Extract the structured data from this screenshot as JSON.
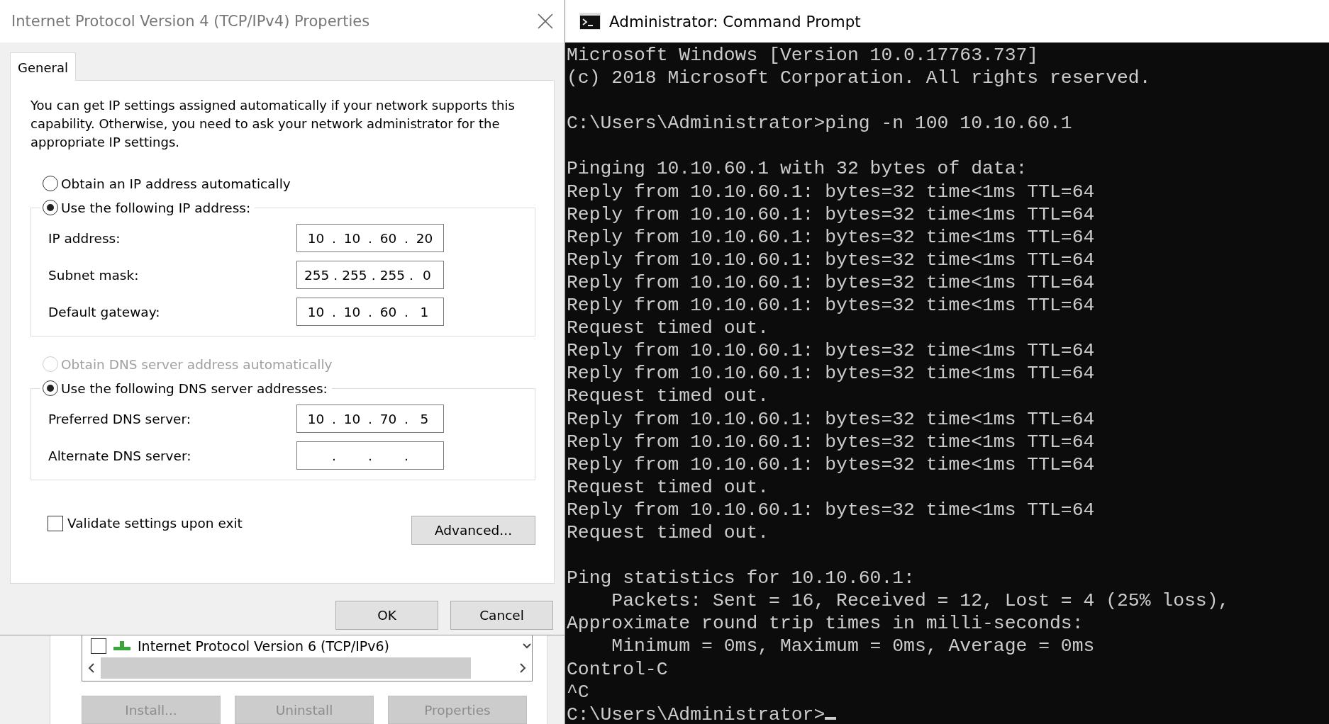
{
  "dialog": {
    "title": "Internet Protocol Version 4 (TCP/IPv4) Properties",
    "tabs": [
      {
        "label": "General",
        "selected": true
      }
    ],
    "intro": "You can get IP settings assigned automatically if your network supports this capability. Otherwise, you need to ask your network administrator for the appropriate IP settings.",
    "ip_mode": [
      {
        "label": "Obtain an IP address automatically",
        "selected": false,
        "disabled": false
      },
      {
        "label": "Use the following IP address:",
        "selected": true,
        "disabled": false
      }
    ],
    "ip_fields": [
      {
        "label": "IP address:",
        "octets": [
          "10",
          "10",
          "60",
          "20"
        ],
        "dots": [
          ".",
          ".",
          "."
        ]
      },
      {
        "label": "Subnet mask:",
        "octets": [
          "255",
          "255",
          "255",
          "0"
        ],
        "dots": [
          ".",
          ".",
          "."
        ]
      },
      {
        "label": "Default gateway:",
        "octets": [
          "10",
          "10",
          "60",
          "1"
        ],
        "dots": [
          ".",
          ".",
          "."
        ]
      }
    ],
    "dns_mode": [
      {
        "label": "Obtain DNS server address automatically",
        "selected": false,
        "disabled": true
      },
      {
        "label": "Use the following DNS server addresses:",
        "selected": true,
        "disabled": false
      }
    ],
    "dns_fields": [
      {
        "label": "Preferred DNS server:",
        "octets": [
          "10",
          "10",
          "70",
          "5"
        ],
        "dots": [
          ".",
          ".",
          "."
        ]
      },
      {
        "label": "Alternate DNS server:",
        "dots": [
          ".",
          ".",
          "."
        ]
      }
    ],
    "validate": {
      "label": "Validate settings upon exit",
      "checked": false
    },
    "advanced_button": "Advanced...",
    "buttons": [
      "OK",
      "Cancel"
    ]
  },
  "background_window": {
    "components": [
      {
        "label": "Internet Protocol Version 6 (TCP/IPv6)",
        "checked": false
      }
    ],
    "buttons": [
      {
        "label": "Install...",
        "disabled": true
      },
      {
        "label": "Uninstall",
        "disabled": true
      },
      {
        "label": "Properties",
        "disabled": true
      }
    ]
  },
  "console": {
    "title": "Administrator: Command Prompt",
    "blocks": [
      [
        "Microsoft Windows [Version 10.0.17763.737]",
        "(c) 2018 Microsoft Corporation. All rights reserved."
      ],
      [
        "C:\\Users\\Administrator>ping -n 100 10.10.60.1"
      ],
      [
        "Pinging 10.10.60.1 with 32 bytes of data:",
        "Reply from 10.10.60.1: bytes=32 time<1ms TTL=64",
        "Reply from 10.10.60.1: bytes=32 time<1ms TTL=64",
        "Reply from 10.10.60.1: bytes=32 time<1ms TTL=64",
        "Reply from 10.10.60.1: bytes=32 time<1ms TTL=64",
        "Reply from 10.10.60.1: bytes=32 time<1ms TTL=64",
        "Reply from 10.10.60.1: bytes=32 time<1ms TTL=64",
        "Request timed out.",
        "Reply from 10.10.60.1: bytes=32 time<1ms TTL=64",
        "Reply from 10.10.60.1: bytes=32 time<1ms TTL=64",
        "Request timed out.",
        "Reply from 10.10.60.1: bytes=32 time<1ms TTL=64",
        "Reply from 10.10.60.1: bytes=32 time<1ms TTL=64",
        "Reply from 10.10.60.1: bytes=32 time<1ms TTL=64",
        "Request timed out.",
        "Reply from 10.10.60.1: bytes=32 time<1ms TTL=64",
        "Request timed out."
      ],
      [
        "Ping statistics for 10.10.60.1:",
        "    Packets: Sent = 16, Received = 12, Lost = 4 (25% loss),",
        "Approximate round trip times in milli-seconds:",
        "    Minimum = 0ms, Maximum = 0ms, Average = 0ms",
        "Control-C",
        "^C"
      ]
    ],
    "prompt": "C:\\Users\\Administrator>",
    "cursor": true
  }
}
